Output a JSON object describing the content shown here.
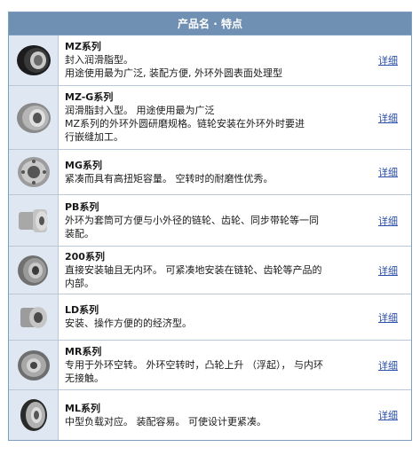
{
  "header": {
    "title": "产品名 · 特点"
  },
  "rows": [
    {
      "title": "MZ系列",
      "lines": [
        "封入润滑脂型。",
        "用途使用最为广泛, 装配方便, 外环外圆表面处理型"
      ],
      "link": "详细"
    },
    {
      "title": "MZ-G系列",
      "lines": [
        "润滑脂封入型。 用途使用最为广泛",
        "MZ系列的外环外圆研磨规格。链轮安装在外环外时要进",
        "行嵌缝加工。"
      ],
      "link": "详细"
    },
    {
      "title": "MG系列",
      "lines": [
        "紧凑而具有高扭矩容量。 空转时的耐磨性优秀。"
      ],
      "link": "详细"
    },
    {
      "title": "PB系列",
      "lines": [
        "外环为套筒可方便与小外径的链轮、齿轮、同步带轮等一同",
        "装配。"
      ],
      "link": "详细"
    },
    {
      "title": "200系列",
      "lines": [
        "直接安装轴且无内环。 可紧凑地安装在链轮、齿轮等产品的",
        "内部。"
      ],
      "link": "详细"
    },
    {
      "title": "LD系列",
      "lines": [
        "安装、操作方便的的经济型。"
      ],
      "link": "详细"
    },
    {
      "title": "MR系列",
      "lines": [
        "专用于外环空转。 外环空转时，凸轮上升 （浮起）， 与内环",
        "无接触。"
      ],
      "link": "详细"
    },
    {
      "title": "ML系列",
      "lines": [
        "中型负载对应。 装配容易。 可使设计更紧凑。"
      ],
      "link": "详细"
    }
  ]
}
